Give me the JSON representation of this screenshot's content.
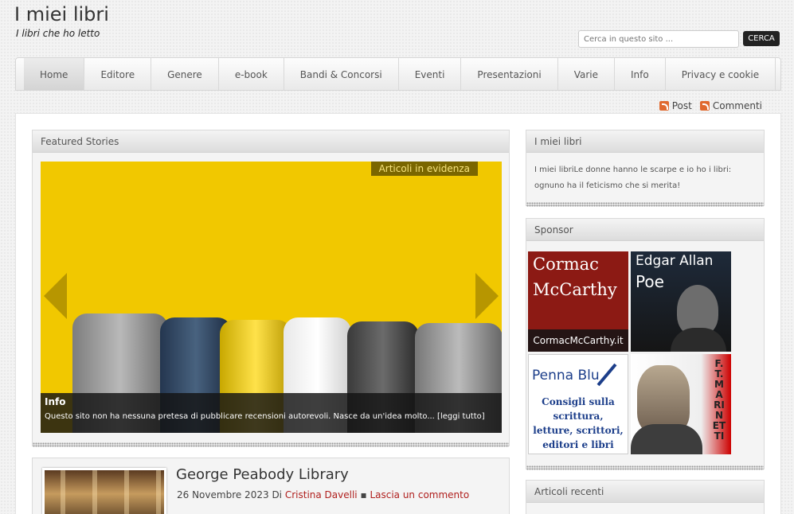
{
  "site": {
    "title": "I miei libri",
    "tagline": "I libri che ho letto"
  },
  "search": {
    "placeholder": "Cerca in questo sito ...",
    "button": "CERCA"
  },
  "nav": [
    "Home",
    "Editore",
    "Genere",
    "e-book",
    "Bandi & Concorsi",
    "Eventi",
    "Presentazioni",
    "Varie",
    "Info",
    "Privacy e cookie"
  ],
  "feeds": {
    "posts": "Post",
    "comments": "Commenti"
  },
  "featured": {
    "heading": "Featured Stories",
    "badge": "Articoli in evidenza",
    "caption_title": "Info",
    "caption_text": "Questo sito non ha nessuna pretesa di pubblicare recensioni autorevoli. Nasce da un'idea molto... [leggi tutto]"
  },
  "post": {
    "title": "George Peabody Library",
    "date": "26 Novembre 2023",
    "by": "Di",
    "author": "Cristina Davelli",
    "separator": "▪",
    "comment_link": "Lascia un commento"
  },
  "sidebar": {
    "about_heading": "I miei libri",
    "about_text": "I miei libriLe donne hanno le scarpe e io ho i libri: ognuno ha il feticismo che si merita!",
    "sponsor_heading": "Sponsor",
    "ads": [
      {
        "line1": "Cormac",
        "line2": "McCarthy",
        "footer": "CormacMcCarthy.it"
      },
      {
        "line1": "Edgar Allan",
        "line2": "Poe"
      },
      {
        "title": "Penna Blu",
        "text": "Consigli sulla scrittura, letture, scrittori, editori e libri"
      },
      {
        "text": "F.T. MARINETTI"
      }
    ],
    "recent_heading": "Articoli recenti"
  },
  "colors": {
    "slide_bg": "#f1c800",
    "link_red": "#b0201e",
    "badge_bg": "#7a6600"
  }
}
